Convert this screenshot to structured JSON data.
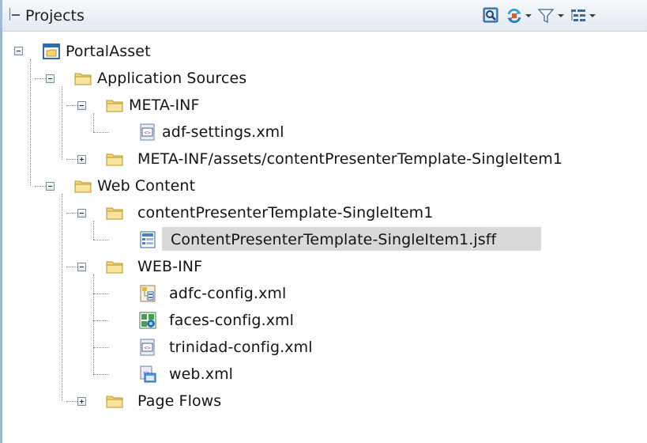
{
  "panel": {
    "title": "Projects"
  },
  "toolbar": {
    "icons": [
      "search-icon",
      "sync-icon",
      "filter-icon",
      "options-icon"
    ]
  },
  "tree": {
    "root": {
      "label": "PortalAsset",
      "icon": "project-icon",
      "expanded": true
    },
    "app_sources": {
      "label": "Application Sources",
      "icon": "folder-icon",
      "expanded": true
    },
    "meta_inf": {
      "label": "META-INF",
      "icon": "folder-icon",
      "expanded": true
    },
    "adf_settings": {
      "label": "adf-settings.xml",
      "icon": "xml-file-icon"
    },
    "meta_inf_assets": {
      "label": "META-INF/assets/contentPresenterTemplate-SingleItem1",
      "icon": "folder-icon",
      "expanded": false
    },
    "web_content": {
      "label": "Web Content",
      "icon": "folder-icon",
      "expanded": true
    },
    "cp_template_folder": {
      "label": "contentPresenterTemplate-SingleItem1",
      "icon": "folder-icon",
      "expanded": true
    },
    "cp_template_jsff": {
      "label": "ContentPresenterTemplate-SingleItem1.jsff",
      "icon": "jsff-file-icon",
      "selected": true
    },
    "web_inf": {
      "label": "WEB-INF",
      "icon": "folder-icon",
      "expanded": true
    },
    "adfc_config": {
      "label": "adfc-config.xml",
      "icon": "adfc-config-icon"
    },
    "faces_config": {
      "label": "faces-config.xml",
      "icon": "faces-config-icon"
    },
    "trinidad_config": {
      "label": "trinidad-config.xml",
      "icon": "xml-file-icon"
    },
    "web_xml": {
      "label": "web.xml",
      "icon": "web-xml-icon"
    },
    "page_flows": {
      "label": "Page Flows",
      "icon": "folder-icon",
      "expanded": false
    }
  },
  "colors": {
    "folder": "#f2d675",
    "selection": "#d9d9d9",
    "header_border": "#c9d3df"
  }
}
